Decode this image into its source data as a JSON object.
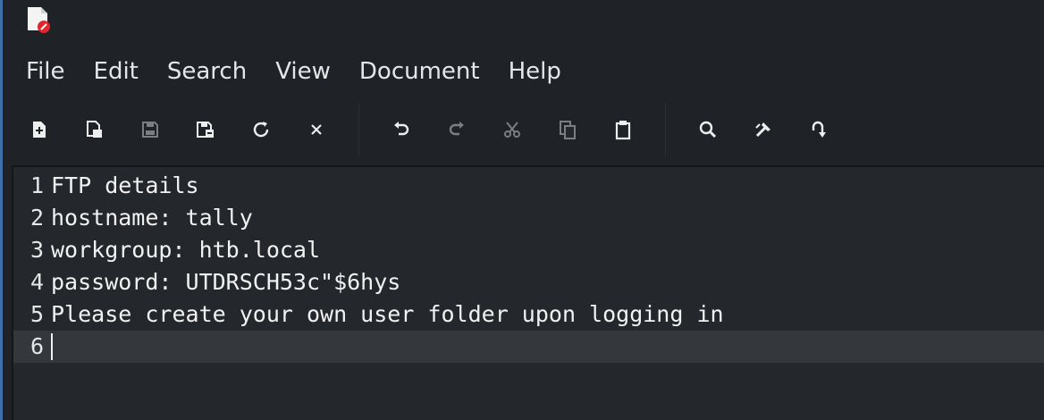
{
  "app": {
    "icon": "text-editor-document-icon"
  },
  "menu": {
    "items": [
      "File",
      "Edit",
      "Search",
      "View",
      "Document",
      "Help"
    ]
  },
  "toolbar": {
    "groups": [
      [
        "new-document-icon",
        "new-window-icon",
        "save-icon",
        "save-as-icon",
        "reload-icon",
        "close-icon"
      ],
      [
        "undo-icon",
        "redo-icon",
        "cut-icon",
        "copy-icon",
        "paste-icon"
      ],
      [
        "find-icon",
        "find-replace-icon",
        "go-to-line-icon"
      ]
    ]
  },
  "editor": {
    "lines": [
      {
        "number": "1",
        "text": "FTP details"
      },
      {
        "number": "2",
        "text": "hostname: tally"
      },
      {
        "number": "3",
        "text": "workgroup: htb.local"
      },
      {
        "number": "4",
        "text": "password: UTDRSCH53c\"$6hys"
      },
      {
        "number": "5",
        "text": "Please create your own user folder upon logging in"
      },
      {
        "number": "6",
        "text": ""
      }
    ],
    "current_line": 6
  },
  "colors": {
    "background": "#1f2226",
    "editor_background": "#24272b",
    "current_line": "#34373b",
    "text": "#f0f0f0",
    "icon_badge": "#e0272d"
  }
}
